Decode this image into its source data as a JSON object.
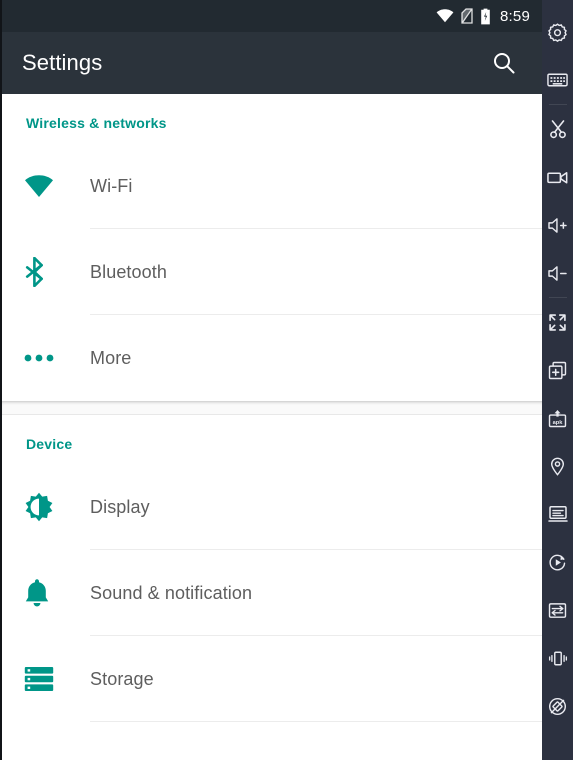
{
  "statusbar": {
    "time": "8:59",
    "icons": [
      {
        "name": "wifi-icon",
        "label": "Wi-Fi signal"
      },
      {
        "name": "no-sim-icon",
        "label": "No SIM / signal off"
      },
      {
        "name": "battery-charging-icon",
        "label": "Battery charging"
      }
    ]
  },
  "toolbar": {
    "title": "Settings",
    "search_label": "Search"
  },
  "sections": [
    {
      "header": "Wireless & networks",
      "rows": [
        {
          "icon": "wifi-icon",
          "label": "Wi-Fi"
        },
        {
          "icon": "bluetooth-icon",
          "label": "Bluetooth"
        },
        {
          "icon": "more-dots-icon",
          "label": "More"
        }
      ]
    },
    {
      "header": "Device",
      "rows": [
        {
          "icon": "brightness-icon",
          "label": "Display"
        },
        {
          "icon": "bell-icon",
          "label": "Sound & notification"
        },
        {
          "icon": "storage-icon",
          "label": "Storage"
        }
      ]
    }
  ],
  "sidebar": {
    "items": [
      {
        "name": "settings-gear-icon",
        "label": "Extended controls"
      },
      {
        "name": "keyboard-icon",
        "label": "Keyboard input"
      },
      {
        "name": "scissors-icon",
        "label": "Take screenshot / snip"
      },
      {
        "name": "video-camera-icon",
        "label": "Record screen"
      },
      {
        "name": "volume-up-icon",
        "label": "Volume up"
      },
      {
        "name": "volume-down-icon",
        "label": "Volume down"
      },
      {
        "name": "fullscreen-icon",
        "label": "Fullscreen"
      },
      {
        "name": "add-screen-icon",
        "label": "Add / new window"
      },
      {
        "name": "apk-install-icon",
        "label": "Install APK"
      },
      {
        "name": "location-pin-icon",
        "label": "Location"
      },
      {
        "name": "logcat-icon",
        "label": "Logcat / console"
      },
      {
        "name": "play-rotate-icon",
        "label": "Play / resume"
      },
      {
        "name": "transfer-icon",
        "label": "Data transfer"
      },
      {
        "name": "vibrate-icon",
        "label": "Vibrate"
      },
      {
        "name": "rotate-screen-icon",
        "label": "Rotate screen"
      }
    ]
  },
  "colors": {
    "accent_teal": "#009688",
    "toolbar_bg": "#2b333b",
    "statusbar_bg": "#222a31",
    "sidebar_bg": "#2c3140",
    "label_gray": "#5e5e5e"
  }
}
